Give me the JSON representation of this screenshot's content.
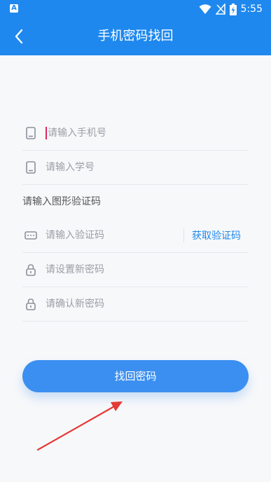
{
  "status_bar": {
    "time": "5:55",
    "app_indicator": "A",
    "icons": [
      "wifi-icon",
      "no-signal-icon",
      "battery-charging-icon"
    ]
  },
  "app_bar": {
    "title": "手机密码找回",
    "back_icon": "chevron-left-icon"
  },
  "form": {
    "phone": {
      "placeholder": "请输入手机号",
      "icon": "phone-icon"
    },
    "student_id": {
      "placeholder": "请输入学号",
      "icon": "phone-icon"
    },
    "captcha_label": "请输入图形验证码",
    "sms_code": {
      "placeholder": "请输入验证码",
      "icon": "keyboard-icon",
      "action_label": "获取验证码"
    },
    "new_password": {
      "placeholder": "请设置新密码",
      "icon": "lock-icon"
    },
    "confirm_password": {
      "placeholder": "请确认新密码",
      "icon": "lock-icon"
    }
  },
  "submit_label": "找回密码",
  "colors": {
    "primary": "#1e88ee",
    "button": "#3b8ff0",
    "annotation_arrow": "#e53935"
  }
}
